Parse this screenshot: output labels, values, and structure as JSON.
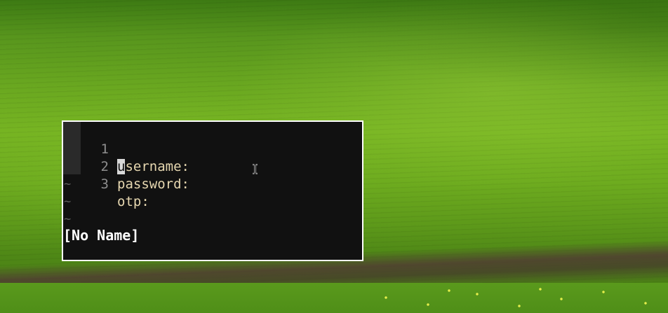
{
  "wallpaper": {
    "name": "green hills wallpaper"
  },
  "editor": {
    "lines": [
      {
        "number": "1",
        "cursor_char": "u",
        "rest": "sername:"
      },
      {
        "number": "2",
        "cursor_char": "",
        "rest": "password:"
      },
      {
        "number": "3",
        "cursor_char": "",
        "rest": "otp:"
      }
    ],
    "empty_line_marker": "~",
    "status": "[No Name]"
  },
  "colors": {
    "background": "#111111",
    "text": "#e6d7b0",
    "line_number": "#8e8e8e",
    "tilde": "#5e5e5e",
    "border": "#ffffff",
    "status": "#ffffff"
  },
  "pointer": {
    "icon": "ibeam-cursor-icon"
  }
}
